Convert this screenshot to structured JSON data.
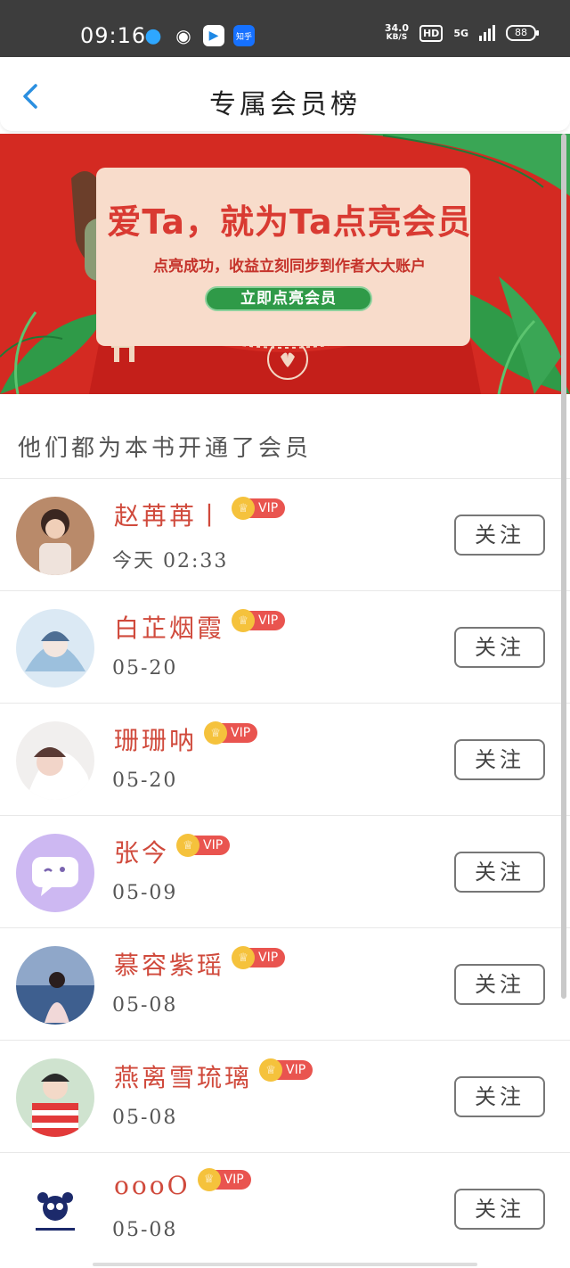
{
  "status_bar": {
    "time": "09:16",
    "speed_value": "34.0",
    "speed_unit": "KB/S",
    "hd": "HD",
    "network": "5G",
    "battery": "88",
    "app_zhihu": "知乎"
  },
  "header": {
    "title": "专属会员榜"
  },
  "banner": {
    "headline": "爱Ta，就为Ta点亮会员",
    "subtitle": "点亮成功，收益立刻同步到作者大大账户",
    "cta": "立即点亮会员"
  },
  "section_title": "他们都为本书开通了会员",
  "vip_label": "VIP",
  "follow_label": "关注",
  "members": [
    {
      "name": "赵苒苒丨",
      "time": "今天 02:33"
    },
    {
      "name": "白芷烟霞",
      "time": "05-20"
    },
    {
      "name": "珊珊呐",
      "time": "05-20"
    },
    {
      "name": "张今",
      "time": "05-09"
    },
    {
      "name": "慕容紫瑶",
      "time": "05-08"
    },
    {
      "name": "燕离雪琉璃",
      "time": "05-08"
    },
    {
      "name": "oooO",
      "time": "05-08"
    }
  ],
  "colors": {
    "banner_red": "#d42a22",
    "name_red": "#d04a3c",
    "vip_red": "#e9544f",
    "crown_gold": "#f5c23c",
    "back_blue": "#2b8fe0"
  }
}
